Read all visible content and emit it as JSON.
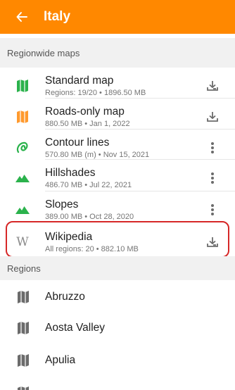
{
  "header": {
    "title": "Italy"
  },
  "sections": {
    "regionwide": "Regionwide maps",
    "regions": "Regions"
  },
  "maps": [
    {
      "name": "Standard map",
      "sub": "Regions: 19/20 • 1896.50 MB",
      "icon": "map-icon",
      "color": "#2bb24c",
      "action": "download-done-icon"
    },
    {
      "name": "Roads-only map",
      "sub": "880.50 MB • Jan 1, 2022",
      "icon": "map-icon",
      "color": "#ff9a2e",
      "action": "download-icon"
    },
    {
      "name": "Contour lines",
      "sub": "570.80 MB (m) • Nov 15, 2021",
      "icon": "contour-icon",
      "color": "#2bb24c",
      "action": "more-vert-icon"
    },
    {
      "name": "Hillshades",
      "sub": "486.70 MB • Jul 22, 2021",
      "icon": "hillshade-icon",
      "color": "#2bb24c",
      "action": "more-vert-icon"
    },
    {
      "name": "Slopes",
      "sub": "389.00 MB • Oct 28, 2020",
      "icon": "slope-icon",
      "color": "#2bb24c",
      "action": "more-vert-icon"
    },
    {
      "name": "Wikipedia",
      "sub": "All regions: 20 • 882.10 MB",
      "icon": "wikipedia-icon",
      "glyph": "W",
      "color": "#8a8a8a",
      "action": "download-done-icon"
    }
  ],
  "regions": [
    {
      "name": "Abruzzo"
    },
    {
      "name": "Aosta Valley"
    },
    {
      "name": "Apulia"
    },
    {
      "name": ""
    }
  ],
  "colors": {
    "appbar": "#ff8800",
    "highlight": "#d62727"
  }
}
